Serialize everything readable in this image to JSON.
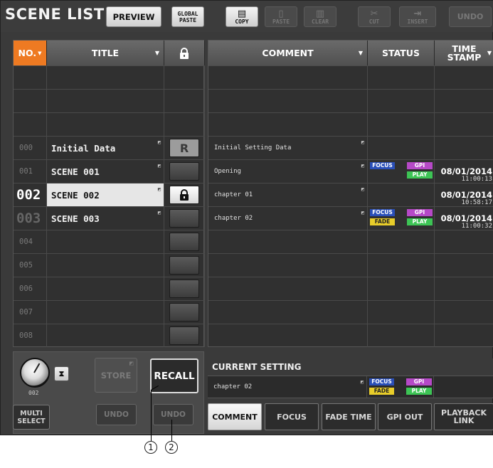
{
  "app_title": "SCENE LIST",
  "toolbar": {
    "preview": "PREVIEW",
    "global_paste": [
      "GLOBAL",
      "PASTE"
    ],
    "copy": "COPY",
    "paste": "PASTE",
    "clear": "CLEAR",
    "cut": "CUT",
    "insert": "INSERT",
    "undo": "UNDO"
  },
  "list_headers": {
    "no": "NO.",
    "title": "TITLE"
  },
  "scenes": [
    {
      "no": "",
      "title": "",
      "lock": "none"
    },
    {
      "no": "",
      "title": "",
      "lock": "none"
    },
    {
      "no": "",
      "title": "",
      "lock": "none"
    },
    {
      "no": "000",
      "title": "Initial Data",
      "lock": "R"
    },
    {
      "no": "001",
      "title": "SCENE 001",
      "lock": "off"
    },
    {
      "no": "002",
      "title": "SCENE 002",
      "lock": "on",
      "selected": true
    },
    {
      "no": "003",
      "title": "SCENE 003",
      "lock": "off"
    },
    {
      "no": "004",
      "title": "",
      "lock": "off"
    },
    {
      "no": "005",
      "title": "",
      "lock": "off"
    },
    {
      "no": "006",
      "title": "",
      "lock": "off"
    },
    {
      "no": "007",
      "title": "",
      "lock": "off"
    },
    {
      "no": "008",
      "title": "",
      "lock": "off"
    }
  ],
  "detail_headers": {
    "comment": "COMMENT",
    "status": "STATUS",
    "timestamp": [
      "TIME",
      "STAMP"
    ]
  },
  "details": [
    {
      "comment": "",
      "tags": [],
      "date": "",
      "time": ""
    },
    {
      "comment": "",
      "tags": [],
      "date": "",
      "time": ""
    },
    {
      "comment": "",
      "tags": [],
      "date": "",
      "time": ""
    },
    {
      "comment": "Initial Setting Data",
      "tags": [],
      "date": "",
      "time": ""
    },
    {
      "comment": "Opening",
      "tags": [
        "FOCUS",
        "GPI",
        "PLAY"
      ],
      "date": "08/01/2014",
      "time": "11:00:13"
    },
    {
      "comment": "chapter 01",
      "tags": [],
      "date": "08/01/2014",
      "time": "10:58:17"
    },
    {
      "comment": "chapter 02",
      "tags": [
        "FOCUS",
        "GPI",
        "FADE",
        "PLAY"
      ],
      "date": "08/01/2014",
      "time": "11:00:32"
    },
    {
      "comment": "",
      "tags": [],
      "date": "",
      "time": ""
    },
    {
      "comment": "",
      "tags": [],
      "date": "",
      "time": ""
    },
    {
      "comment": "",
      "tags": [],
      "date": "",
      "time": ""
    },
    {
      "comment": "",
      "tags": [],
      "date": "",
      "time": ""
    },
    {
      "comment": "",
      "tags": [],
      "date": "",
      "time": ""
    }
  ],
  "controls": {
    "knob_value": "002",
    "store": "STORE",
    "recall": "RECALL",
    "multi_select": [
      "MULTI",
      "SELECT"
    ],
    "undo_store": "UNDO",
    "undo_recall": "UNDO"
  },
  "current_setting": {
    "title": "CURRENT SETTING",
    "comment": "chapter 02",
    "tags": [
      "FOCUS",
      "GPI",
      "FADE",
      "PLAY"
    ]
  },
  "tabs": [
    "COMMENT",
    "FOCUS",
    "FADE TIME",
    "GPI OUT",
    "PLAYBACK LINK"
  ],
  "active_tab": "COMMENT",
  "callouts": [
    "1",
    "2"
  ],
  "colors": {
    "no_header": "#ee7a22",
    "focus": "#2a4fb8",
    "gpi": "#b649c7",
    "play": "#3dc455",
    "fade": "#e8cd2a"
  }
}
